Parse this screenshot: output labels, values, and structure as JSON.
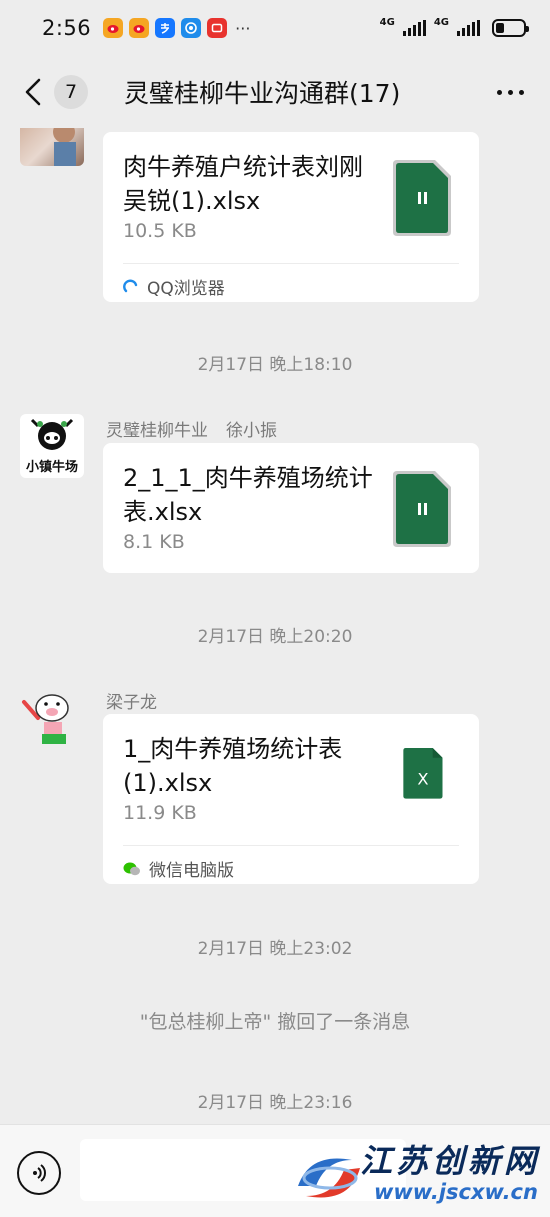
{
  "status_bar": {
    "time": "2:56",
    "network_1": "4G",
    "network_2": "4G",
    "battery_level": 0.3,
    "app_icons": [
      "weibo-icon",
      "weibo-icon",
      "alipay-icon",
      "browser-icon",
      "message-icon",
      "more-notifications-icon"
    ],
    "more": "···"
  },
  "nav": {
    "unread_count": "7",
    "title": "灵璧桂柳牛业沟通群(17)"
  },
  "messages": [
    {
      "type": "file",
      "file_name": "肉牛养殖户统计表刘刚吴锐(1).xlsx",
      "file_size": "10.5 KB",
      "icon": "paused-download-icon",
      "source": "QQ浏览器"
    },
    {
      "type": "time",
      "text": "2月17日 晚上18:10"
    },
    {
      "type": "file",
      "sender_group": "灵璧桂柳牛业",
      "sender_name": "徐小振",
      "avatar_text": "小镇牛场",
      "file_name": "2_1_1_肉牛养殖场统计表.xlsx",
      "file_size": "8.1 KB",
      "icon": "paused-download-icon"
    },
    {
      "type": "time",
      "text": "2月17日 晚上20:20"
    },
    {
      "type": "file",
      "sender_name": "梁子龙",
      "file_name": "1_肉牛养殖场统计表(1).xlsx",
      "file_size": "11.9 KB",
      "icon": "excel-icon",
      "icon_letter": "X",
      "source": "微信电脑版"
    },
    {
      "type": "time",
      "text": "2月17日 晚上23:02"
    },
    {
      "type": "system",
      "text": "\"包总桂柳上帝\" 撤回了一条消息"
    },
    {
      "type": "time",
      "text": "2月17日 晚上23:16"
    }
  ],
  "input": {
    "value": "",
    "placeholder": ""
  },
  "watermark": {
    "text": "江苏创新网",
    "url": "www.jscxw.cn"
  },
  "colors": {
    "background": "#ededed",
    "card": "#ffffff",
    "excel_green": "#1e7145",
    "muted_text": "#8a8a8a"
  }
}
